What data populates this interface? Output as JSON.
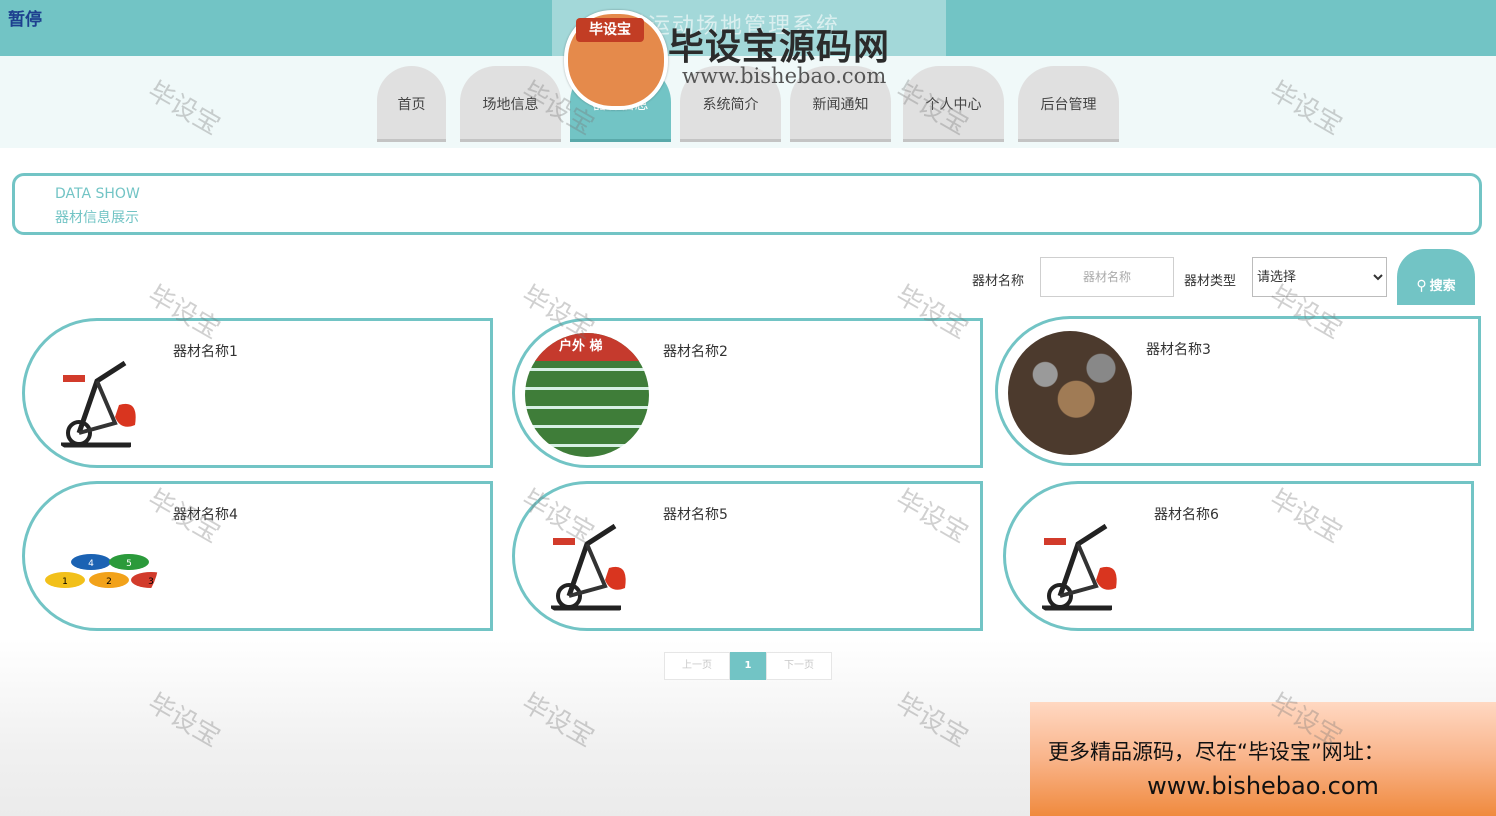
{
  "player": {
    "pause_label": "暂停"
  },
  "header": {
    "site_title": "大学运动场地管理系统"
  },
  "logo": {
    "badge": "毕设宝",
    "name": "毕设宝源码网",
    "url": "www.bishebao.com"
  },
  "nav": [
    {
      "label": "首页",
      "active": false
    },
    {
      "label": "场地信息",
      "active": false
    },
    {
      "label": "器材信息",
      "active": true
    },
    {
      "label": "系统简介",
      "active": false
    },
    {
      "label": "新闻通知",
      "active": false
    },
    {
      "label": "个人中心",
      "active": false
    },
    {
      "label": "后台管理",
      "active": false
    }
  ],
  "section": {
    "title_en": "DATA SHOW",
    "title_cn": "器材信息展示"
  },
  "search": {
    "name_label": "器材名称",
    "name_placeholder": "器材名称",
    "type_label": "器材类型",
    "type_selected": "请选择",
    "button_label": "搜索"
  },
  "items": [
    {
      "name": "器材名称1",
      "image": "exercise-bike"
    },
    {
      "name": "器材名称2",
      "image": "agility-ladder"
    },
    {
      "name": "器材名称3",
      "image": "gym-equipment"
    },
    {
      "name": "器材名称4",
      "image": "numbered-floor-markers"
    },
    {
      "name": "器材名称5",
      "image": "exercise-bike"
    },
    {
      "name": "器材名称6",
      "image": "exercise-bike"
    }
  ],
  "field_tag": "户外 梯",
  "markers": [
    "4",
    "5",
    "1",
    "2",
    "3"
  ],
  "pagination": {
    "prev": "上一页",
    "current": "1",
    "next": "下一页"
  },
  "watermark": "毕设宝",
  "promo": {
    "line1": "更多精品源码，尽在“毕设宝”网址：",
    "line2": "www.bishebao.com"
  },
  "colors": {
    "accent": "#72c4c5",
    "pause_text": "#1d3f8f",
    "promo_top": "#ffd8c2",
    "promo_bottom": "#f08a3e"
  }
}
